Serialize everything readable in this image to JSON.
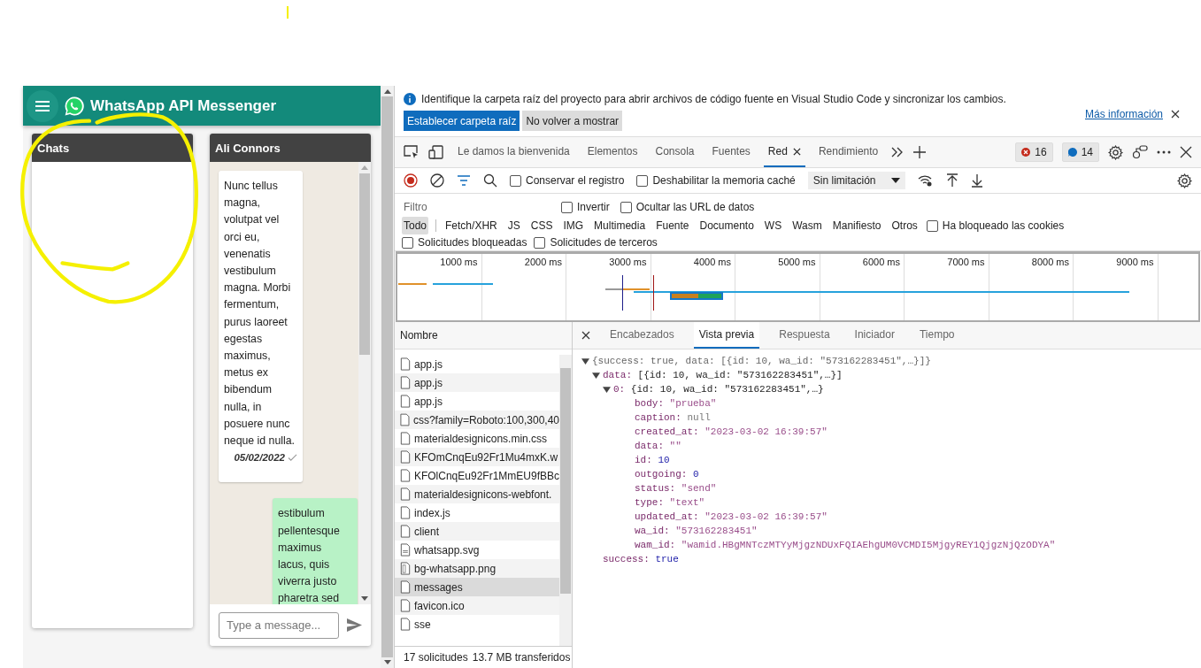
{
  "app": {
    "title": "WhatsApp API Messenger",
    "chats_panel": {
      "title": "Chats"
    },
    "chat": {
      "contact": "Ali Connors",
      "messages": [
        {
          "outgoing": false,
          "text": "Nunc tellus magna, volutpat vel orci eu, venenatis vestibulum magna. Morbi fermentum, purus laoreet egestas maximus, metus ex bibendum nulla, in posuere nunc neque id nulla.",
          "time": "05/02/2022"
        },
        {
          "outgoing": true,
          "text": "estibulum pellentesque maximus lacus, quis viverra justo pharetra sed"
        }
      ],
      "input": {
        "placeholder": "Type a message..."
      }
    }
  },
  "devtools": {
    "infobar": {
      "message": "Identifique la carpeta raíz del proyecto para abrir archivos de código fuente en Visual Studio Code y sincronizar los cambios.",
      "buttons": [
        {
          "label": "Establecer carpeta raíz",
          "primary": true
        },
        {
          "label": "No volver a mostrar",
          "primary": false
        }
      ],
      "link": "Más información"
    },
    "tabs": [
      {
        "label": "Le damos la bienvenida",
        "selected": false
      },
      {
        "label": "Elementos",
        "selected": false
      },
      {
        "label": "Consola",
        "selected": false
      },
      {
        "label": "Fuentes",
        "selected": false
      },
      {
        "label": "Red",
        "selected": true
      },
      {
        "label": "Rendimiento",
        "selected": false
      }
    ],
    "errors": "16",
    "messages": "14",
    "toolbar": {
      "checkboxes": [
        {
          "label": "Conservar el registro",
          "checked": false
        },
        {
          "label": "Deshabilitar la memoria caché",
          "checked": false
        }
      ],
      "throttling": "Sin limitación"
    },
    "filter": {
      "placeholder": "Filtro",
      "checkboxes": [
        {
          "label": "Invertir",
          "checked": false
        },
        {
          "label": "Ocultar las URL de datos",
          "checked": false
        }
      ]
    },
    "types": [
      {
        "label": "Todo",
        "selected": true
      },
      {
        "label": "Fetch/XHR",
        "selected": false
      },
      {
        "label": "JS",
        "selected": false
      },
      {
        "label": "CSS",
        "selected": false
      },
      {
        "label": "IMG",
        "selected": false
      },
      {
        "label": "Multimedia",
        "selected": false
      },
      {
        "label": "Fuente",
        "selected": false
      },
      {
        "label": "Documento",
        "selected": false
      },
      {
        "label": "WS",
        "selected": false
      },
      {
        "label": "Wasm",
        "selected": false
      },
      {
        "label": "Manifiesto",
        "selected": false
      },
      {
        "label": "Otros",
        "selected": false
      }
    ],
    "type_checkboxes": [
      {
        "label": "Ha bloqueado las cookies",
        "checked": false
      },
      {
        "label": "Solicitudes bloqueadas",
        "checked": false
      },
      {
        "label": "Solicitudes de terceros",
        "checked": false
      }
    ],
    "timeline_ticks": [
      "1000 ms",
      "2000 ms",
      "3000 ms",
      "4000 ms",
      "5000 ms",
      "6000 ms",
      "7000 ms",
      "8000 ms",
      "9000 ms"
    ],
    "requests": {
      "header": "Nombre",
      "items": [
        {
          "name": "app.js",
          "kind": "file",
          "selected": false
        },
        {
          "name": "app.js",
          "kind": "file",
          "selected": false
        },
        {
          "name": "app.js",
          "kind": "file",
          "selected": false
        },
        {
          "name": "css?family=Roboto:100,300,40",
          "kind": "file",
          "selected": false
        },
        {
          "name": "materialdesignicons.min.css",
          "kind": "file",
          "selected": false
        },
        {
          "name": "KFOmCnqEu92Fr1Mu4mxK.w",
          "kind": "file",
          "selected": false
        },
        {
          "name": "KFOlCnqEu92Fr1MmEU9fBBc",
          "kind": "file",
          "selected": false
        },
        {
          "name": "materialdesignicons-webfont.",
          "kind": "file",
          "selected": false
        },
        {
          "name": "index.js",
          "kind": "file",
          "selected": false
        },
        {
          "name": "client",
          "kind": "file",
          "selected": false
        },
        {
          "name": "whatsapp.svg",
          "kind": "svg",
          "selected": false
        },
        {
          "name": "bg-whatsapp.png",
          "kind": "image",
          "selected": false
        },
        {
          "name": "messages",
          "kind": "file",
          "selected": true
        },
        {
          "name": "favicon.ico",
          "kind": "file",
          "selected": false
        },
        {
          "name": "sse",
          "kind": "file",
          "selected": false
        }
      ],
      "count": "17 solicitudes",
      "transferred": "13.7 MB transferidos"
    },
    "detail_tabs": [
      {
        "label": "Encabezados",
        "selected": false
      },
      {
        "label": "Vista previa",
        "selected": true
      },
      {
        "label": "Respuesta",
        "selected": false
      },
      {
        "label": "Iniciador",
        "selected": false
      },
      {
        "label": "Tiempo",
        "selected": false
      }
    ],
    "preview": {
      "summary": "{success: true, data: [{id: 10, wa_id: \"573162283451\",…}]}",
      "expanded": true,
      "children": [
        {
          "key": "data:",
          "summary": "[{id: 10, wa_id: \"573162283451\",…}]",
          "expanded": true,
          "children": [
            {
              "key": "0:",
              "summary": "{id: 10, wa_id: \"573162283451\",…}",
              "expanded": true,
              "children": [
                {
                  "key": "body:",
                  "value": "\"prueba\"",
                  "kind": "string"
                },
                {
                  "key": "caption:",
                  "value": "null",
                  "kind": "null"
                },
                {
                  "key": "created_at:",
                  "value": "\"2023-03-02 16:39:57\"",
                  "kind": "string"
                },
                {
                  "key": "data:",
                  "value": "\"\"",
                  "kind": "string"
                },
                {
                  "key": "id:",
                  "value": "10",
                  "kind": "number"
                },
                {
                  "key": "outgoing:",
                  "value": "0",
                  "kind": "number"
                },
                {
                  "key": "status:",
                  "value": "\"send\"",
                  "kind": "string"
                },
                {
                  "key": "type:",
                  "value": "\"text\"",
                  "kind": "string"
                },
                {
                  "key": "updated_at:",
                  "value": "\"2023-03-02 16:39:57\"",
                  "kind": "string"
                },
                {
                  "key": "wa_id:",
                  "value": "\"573162283451\"",
                  "kind": "string"
                },
                {
                  "key": "wam_id:",
                  "value": "\"wamid.HBgMNTczMTYyMjgzNDUxFQIAEhgUM0VCMDI5MjgyREY1QjgzNjQzODYA\"",
                  "kind": "string"
                }
              ]
            }
          ]
        },
        {
          "key": "success:",
          "value": "true",
          "kind": "boolean"
        }
      ]
    }
  }
}
